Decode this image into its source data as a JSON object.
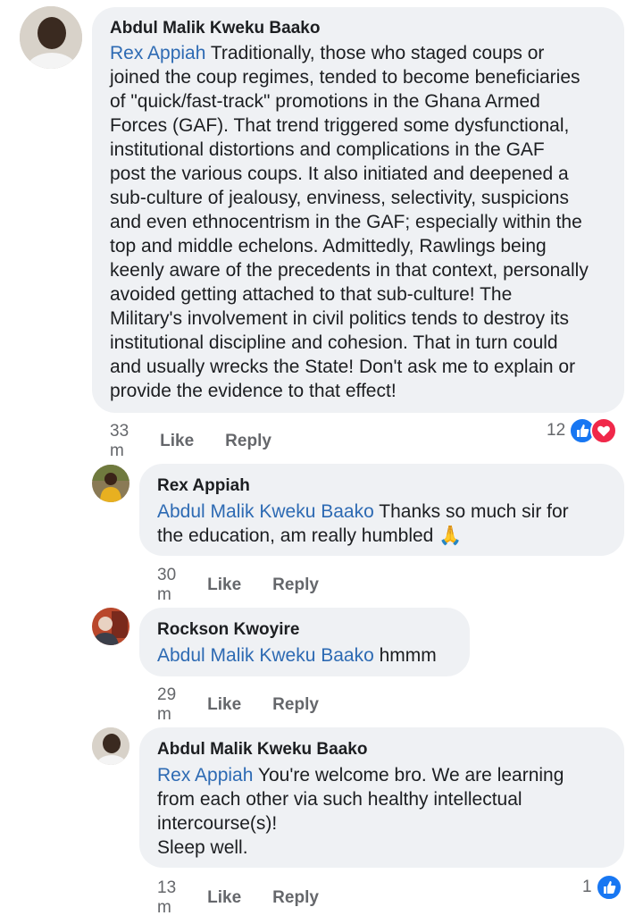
{
  "comments": [
    {
      "author": "Abdul Malik Kweku Baako",
      "mention": "Rex Appiah",
      "body": " Traditionally, those who staged coups or\njoined the coup regimes, tended to become beneficiaries\nof \"quick/fast-track\" promotions in the  Ghana Armed\nForces (GAF).  That trend triggered some  dysfunctional,\ninstitutional distortions and complications in the GAF\npost the various coups. It also initiated and deepened a\nsub-culture of jealousy, enviness, selectivity, suspicions\nand even ethnocentrism in the GAF; especially within the\ntop and middle echelons.  Admittedly,  Rawlings being\nkeenly aware of the precedents in that context, personally\navoided getting attached to that sub-culture! The\nMilitary's involvement in civil politics tends to destroy its\ninstitutional discipline and cohesion.  That in turn could\nand usually wrecks the State! Don't ask me  to explain or\nprovide the evidence to that effect!",
      "time": "33 m",
      "like_label": "Like",
      "reply_label": "Reply",
      "reaction_count": "12",
      "reaction_icons": [
        "like-icon",
        "heart-icon"
      ]
    },
    {
      "author": "Rex Appiah",
      "mention": "Abdul Malik Kweku Baako",
      "body": " Thanks so much sir for\nthe education, am really humbled",
      "emoji": "🙏",
      "time": "30 m",
      "like_label": "Like",
      "reply_label": "Reply"
    },
    {
      "author": "Rockson Kwoyire",
      "mention": "Abdul Malik Kweku Baako",
      "body": " hmmm",
      "time": "29 m",
      "like_label": "Like",
      "reply_label": "Reply"
    },
    {
      "author": "Abdul Malik Kweku Baako",
      "mention": "Rex Appiah",
      "body": " You're welcome bro.  We are learning\nfrom each other via such healthy intellectual\nintercourse(s)!\nSleep well.",
      "time": "13 m",
      "like_label": "Like",
      "reply_label": "Reply",
      "reaction_count": "1",
      "reaction_icons": [
        "like-icon"
      ]
    }
  ],
  "colors": {
    "bubble": "#eff1f4",
    "mention": "#2d6ab3",
    "meta": "#65676b",
    "like_blue": "#1877f2",
    "love_red": "#f0284a"
  }
}
